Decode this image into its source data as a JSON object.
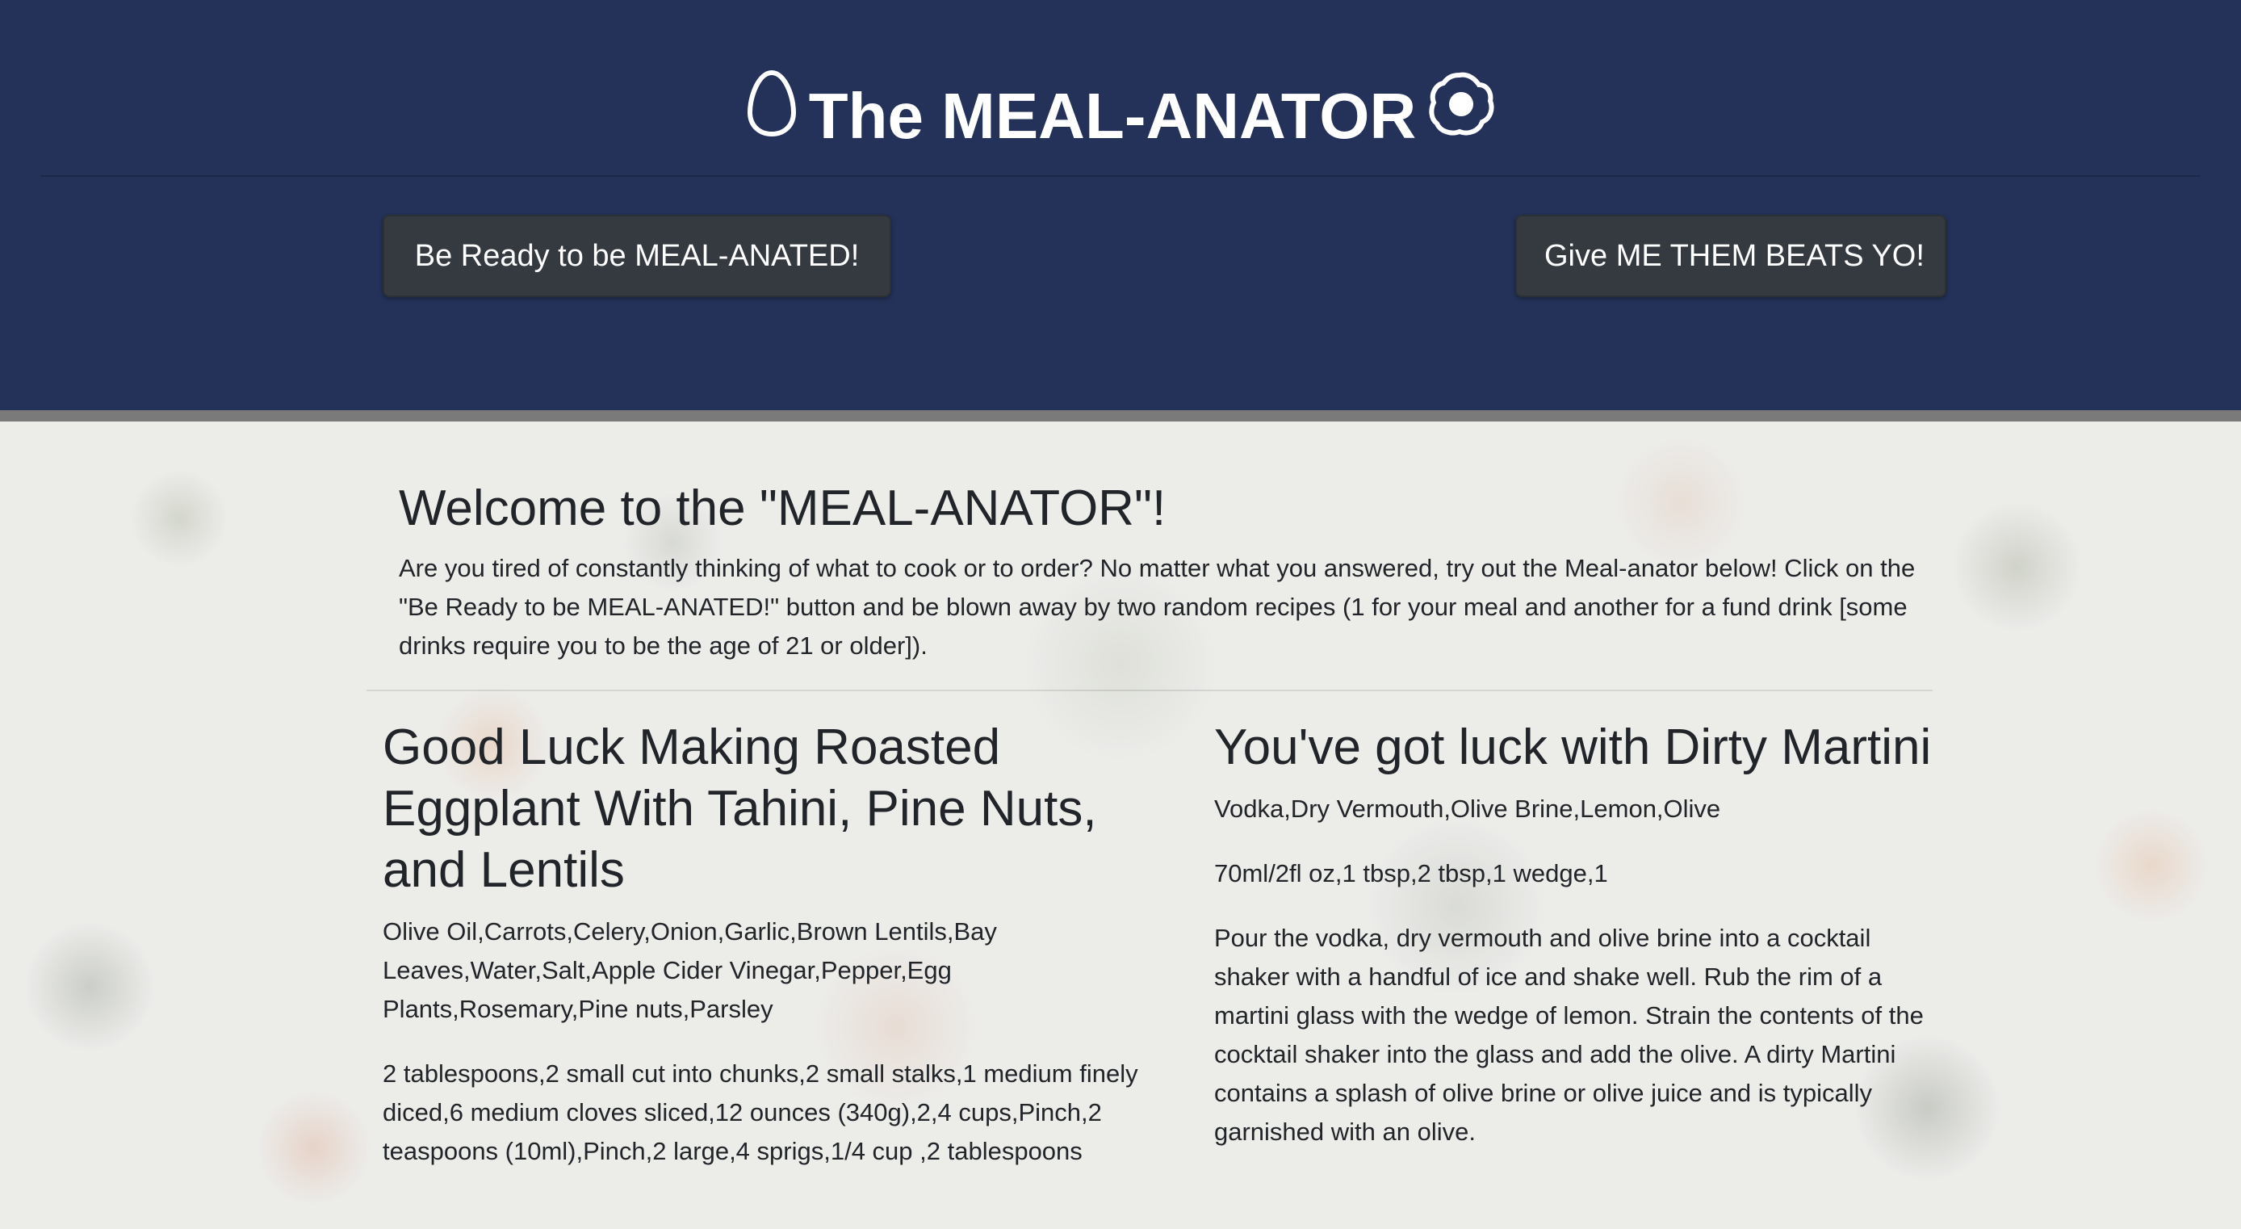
{
  "header": {
    "title": "The MEAL-ANATOR",
    "icons": [
      "egg-icon",
      "fried-egg-icon"
    ],
    "background_color": "#24325a",
    "meal_button_label": "Be Ready to be MEAL-ANATED!",
    "beats_button_label": "Give ME THEM BEATS YO!"
  },
  "welcome": {
    "title": "Welcome to the \"MEAL-ANATOR\"!",
    "text": "Are you tired of constantly thinking of what to cook or to order? No matter what you answered, try out the Meal-anator below! Click on the \"Be Ready to be MEAL-ANATED!\" button and be blown away by two random recipes (1 for your meal and another for a fund drink [some drinks require you to be the age of 21 or older])."
  },
  "meal": {
    "title": "Good Luck Making Roasted Eggplant With Tahini, Pine Nuts, and Lentils",
    "ingredients": "Olive Oil,Carrots,Celery,Onion,Garlic,Brown Lentils,Bay Leaves,Water,Salt,Apple Cider Vinegar,Pepper,Egg Plants,Rosemary,Pine nuts,Parsley",
    "measures": "2 tablespoons,2 small cut into chunks,2 small stalks,1 medium finely diced,6 medium cloves sliced,12 ounces (340g),2,4 cups,Pinch,2 teaspoons (10ml),Pinch,2 large,4 sprigs,1/4 cup ,2 tablespoons"
  },
  "drink": {
    "title": "You've got luck with Dirty Martini",
    "ingredients": "Vodka,Dry Vermouth,Olive Brine,Lemon,Olive",
    "measures": "70ml/2fl oz,1 tbsp,2 tbsp,1 wedge,1",
    "instructions": "Pour the vodka, dry vermouth and olive brine into a cocktail shaker with a handful of ice and shake well. Rub the rim of a martini glass with the wedge of lemon. Strain the contents of the cocktail shaker into the glass and add the olive. A dirty Martini contains a splash of olive brine or olive juice and is typically garnished with an olive."
  }
}
